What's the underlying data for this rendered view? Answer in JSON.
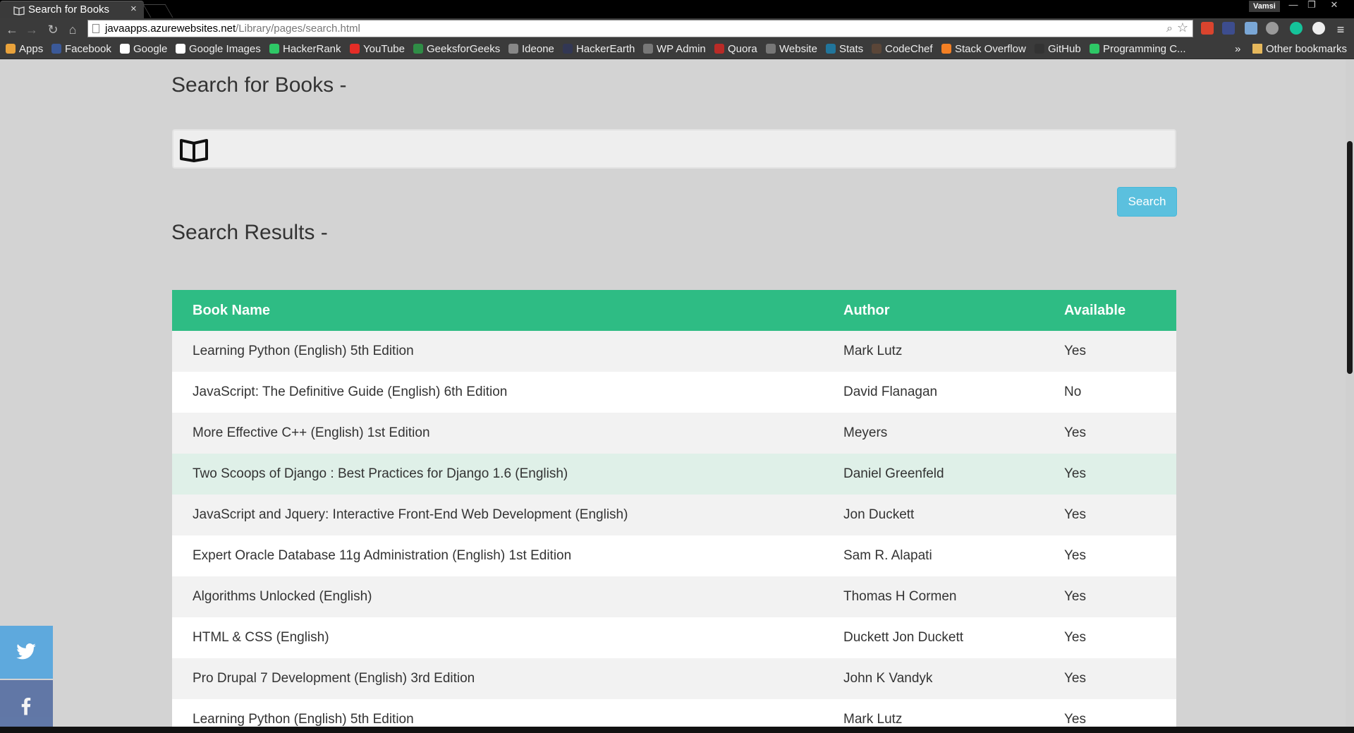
{
  "browser": {
    "tab_title": "Search for Books",
    "tab_close": "×",
    "user_name": "Vamsi",
    "url_host": "javaapps.azurewebsites.net",
    "url_path": "/Library/pages/search.html",
    "window_buttons": [
      "—",
      "❐",
      "✕"
    ]
  },
  "bookmarks": [
    {
      "label": "Apps",
      "icon": "apps-grid-icon",
      "color": "#e9a23b"
    },
    {
      "label": "Facebook",
      "icon": "facebook-icon",
      "color": "#3b5998"
    },
    {
      "label": "Google",
      "icon": "google-icon",
      "color": "#ffffff"
    },
    {
      "label": "Google Images",
      "icon": "google-icon",
      "color": "#ffffff"
    },
    {
      "label": "HackerRank",
      "icon": "hackerrank-icon",
      "color": "#2ec866"
    },
    {
      "label": "YouTube",
      "icon": "youtube-icon",
      "color": "#e52d27"
    },
    {
      "label": "GeeksforGeeks",
      "icon": "geeksforgeeks-icon",
      "color": "#2f8d46"
    },
    {
      "label": "Ideone",
      "icon": "ideone-icon",
      "color": "#888888"
    },
    {
      "label": "HackerEarth",
      "icon": "hackerearth-icon",
      "color": "#323754"
    },
    {
      "label": "WP Admin",
      "icon": "wp-admin-icon",
      "color": "#777777"
    },
    {
      "label": "Quora",
      "icon": "quora-icon",
      "color": "#b92b27"
    },
    {
      "label": "Website",
      "icon": "website-icon",
      "color": "#777777"
    },
    {
      "label": "Stats",
      "icon": "wordpress-icon",
      "color": "#21759b"
    },
    {
      "label": "CodeChef",
      "icon": "codechef-icon",
      "color": "#5b4638"
    },
    {
      "label": "Stack Overflow",
      "icon": "stackoverflow-icon",
      "color": "#f48024"
    },
    {
      "label": "GitHub",
      "icon": "github-icon",
      "color": "#333333"
    },
    {
      "label": "Programming C...",
      "icon": "hackerrank-icon",
      "color": "#2ec866"
    }
  ],
  "bookmarks_overflow": "»",
  "other_bookmarks": "Other bookmarks",
  "page": {
    "search_heading": "Search for Books -",
    "search_placeholder": "",
    "search_button": "Search",
    "results_heading": "Search Results -"
  },
  "table": {
    "headers": [
      "Book Name",
      "Author",
      "Available"
    ],
    "rows": [
      [
        "Learning Python (English) 5th Edition",
        "Mark Lutz",
        "Yes"
      ],
      [
        "JavaScript: The Definitive Guide (English) 6th Edition",
        "David Flanagan",
        "No"
      ],
      [
        "More Effective C++ (English) 1st Edition",
        "Meyers",
        "Yes"
      ],
      [
        "Two Scoops of Django : Best Practices for Django 1.6 (English)",
        "Daniel Greenfeld",
        "Yes"
      ],
      [
        "JavaScript and Jquery: Interactive Front-End Web Development (English)",
        "Jon Duckett",
        "Yes"
      ],
      [
        "Expert Oracle Database 11g Administration (English) 1st Edition",
        "Sam R. Alapati",
        "Yes"
      ],
      [
        "Algorithms Unlocked (English)",
        "Thomas H Cormen",
        "Yes"
      ],
      [
        "HTML & CSS (English)",
        "Duckett Jon Duckett",
        "Yes"
      ],
      [
        "Pro Drupal 7 Development (English) 3rd Edition",
        "John K Vandyk",
        "Yes"
      ],
      [
        "Learning Python (English) 5th Edition",
        "Mark Lutz",
        "Yes"
      ]
    ],
    "highlighted_row": 3
  },
  "colors": {
    "table_header": "#2ebc84",
    "search_button": "#5bc0de",
    "twitter": "#5ea9dd",
    "facebook": "#3b5998"
  }
}
